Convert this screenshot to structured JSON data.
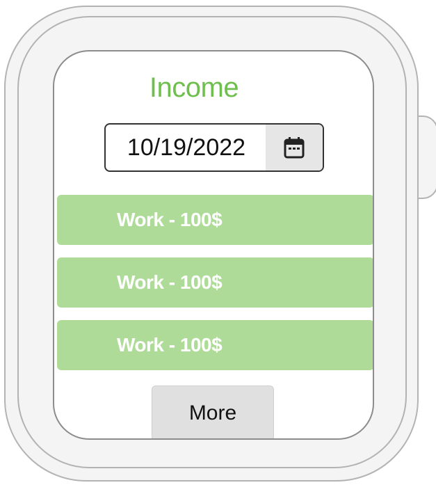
{
  "screen": {
    "title": "Income",
    "date_picker": {
      "value": "10/19/2022",
      "icon": "calendar-icon"
    },
    "items": [
      {
        "label": "Work - 100$"
      },
      {
        "label": "Work - 100$"
      },
      {
        "label": "Work - 100$"
      }
    ],
    "more_label": "More"
  },
  "colors": {
    "title": "#6fbf4f",
    "item_background": "#aedc98",
    "item_text": "#ffffff",
    "button_background": "#e0e0e0"
  }
}
